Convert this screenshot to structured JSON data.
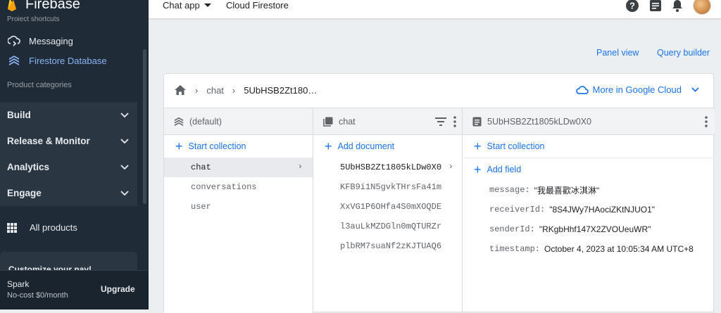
{
  "sidebar": {
    "brand": "Firebase",
    "project_shortcuts_label": "Project shortcuts",
    "shortcuts": [
      {
        "label": "Messaging"
      },
      {
        "label": "Firestore Database"
      }
    ],
    "categories_label": "Product categories",
    "groups": [
      "Build",
      "Release & Monitor",
      "Analytics",
      "Engage"
    ],
    "all_products": "All products",
    "customize": "Customize your nav!",
    "plan_name": "Spark",
    "plan_desc": "No-cost $0/month",
    "upgrade": "Upgrade"
  },
  "topbar": {
    "app_selector": "Chat app",
    "product": "Cloud Firestore"
  },
  "toolbar": {
    "panel_view": "Panel view",
    "query_builder": "Query builder"
  },
  "breadcrumb": {
    "collection": "chat",
    "document": "5UbHSB2Zt180…",
    "more": "More in Google Cloud"
  },
  "columns": {
    "root": {
      "title": "(default)",
      "action": "Start collection",
      "items": [
        "chat",
        "conversations",
        "user"
      ]
    },
    "collection": {
      "title": "chat",
      "action": "Add document",
      "items": [
        "5UbHSB2Zt1805kLDw0X0",
        "KFB9i1N5gvkTHrsFa41m",
        "XxVG1P6OHfa4S0mXOQDE",
        "l3auLkMZDGln0mQTURZr",
        "plbRM7suaNf2zKJTUAQ6"
      ]
    },
    "document": {
      "title": "5UbHSB2Zt1805kLDw0X0",
      "action": "Start collection",
      "add_field": "Add field",
      "fields": [
        {
          "key": "message:",
          "value": "\"我最喜歡冰淇淋\""
        },
        {
          "key": "receiverId:",
          "value": "\"8S4JWy7HAociZKtNJUO1\""
        },
        {
          "key": "senderId:",
          "value": "\"RKgbHhf147X2ZVOUeuWR\""
        },
        {
          "key": "timestamp:",
          "value": "October 4, 2023 at 10:05:34 AM UTC+8"
        }
      ]
    }
  },
  "colors": {
    "accent": "#1a73e8",
    "sidebar_bg": "#1f2b37",
    "active_nav": "#8ab4f8"
  }
}
